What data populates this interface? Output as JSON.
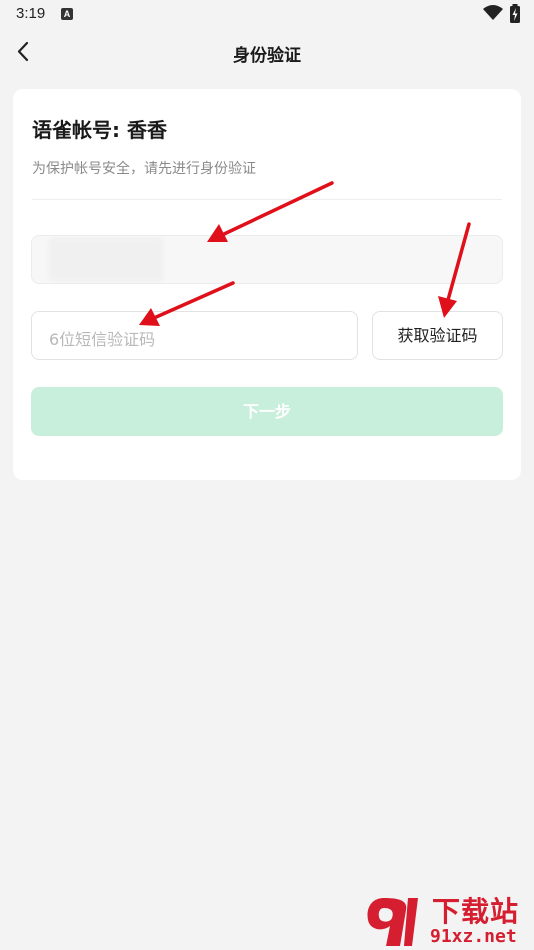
{
  "status_bar": {
    "time": "3:19",
    "notification_icon": "a-letter-icon",
    "wifi_icon": "wifi-icon",
    "battery_icon": "battery-icon"
  },
  "header": {
    "back_icon": "chevron-left-icon",
    "title": "身份验证"
  },
  "card": {
    "account_label": "语雀帐号: ",
    "account_name": "香香",
    "hint": "为保护帐号安全，请先进行身份验证",
    "phone_field": {
      "value": ""
    },
    "code_field": {
      "placeholder": "6位短信验证码",
      "value": ""
    },
    "get_code_label": "获取验证码",
    "next_label": "下一步"
  },
  "watermark": {
    "top": "下载站",
    "bottom": "91xz.net"
  },
  "colors": {
    "background": "#f2f3f2",
    "card": "#ffffff",
    "next_button_disabled": "#c8efdc",
    "annotation_arrow": "#e0101b",
    "watermark": "#d51e30"
  }
}
